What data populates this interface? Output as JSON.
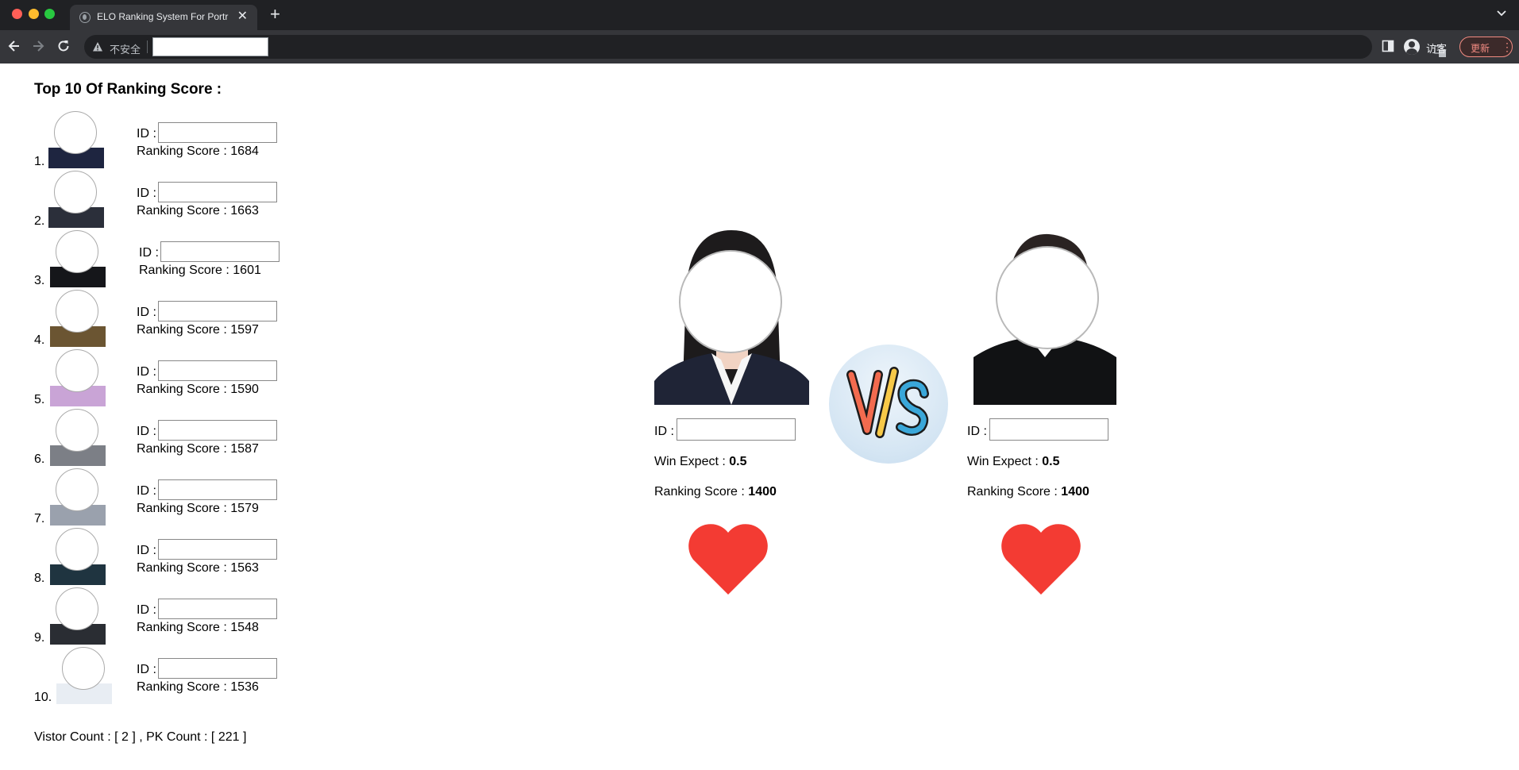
{
  "browser": {
    "tab_title": "ELO Ranking System For Portr",
    "close_glyph": "✕",
    "new_tab_glyph": "+",
    "security_label": "不安全",
    "profile_label": "访客",
    "update_label": "更新",
    "menu_glyph": "⋮"
  },
  "page": {
    "title": "Top 10 Of Ranking Score :",
    "id_label": "ID :",
    "ranking": [
      {
        "rank": "1.",
        "score_text": "Ranking Score : 1684",
        "shirt": "#1e2540"
      },
      {
        "rank": "2.",
        "score_text": "Ranking Score : 1663",
        "shirt": "#2b2f3a"
      },
      {
        "rank": "3.",
        "score_text": "Ranking Score : 1601",
        "shirt": "#15161a"
      },
      {
        "rank": "4.",
        "score_text": "Ranking Score : 1597",
        "shirt": "#6b5532"
      },
      {
        "rank": "5.",
        "score_text": "Ranking Score : 1590",
        "shirt": "#c9a4d6"
      },
      {
        "rank": "6.",
        "score_text": "Ranking Score : 1587",
        "shirt": "#7c7f86"
      },
      {
        "rank": "7.",
        "score_text": "Ranking Score : 1579",
        "shirt": "#9aa1ad"
      },
      {
        "rank": "8.",
        "score_text": "Ranking Score : 1563",
        "shirt": "#1f3440"
      },
      {
        "rank": "9.",
        "score_text": "Ranking Score : 1548",
        "shirt": "#2a2d33"
      },
      {
        "rank": "10.",
        "score_text": "Ranking Score : 1536",
        "shirt": "#e8edf3"
      }
    ],
    "footer": "Vistor Count : [ 2 ] , PK Count : [ 221 ]",
    "contestants": [
      {
        "id_label": "ID :",
        "win_label": "Win Expect :",
        "win_value": "0.5",
        "score_label": "Ranking Score :",
        "score_value": "1400"
      },
      {
        "id_label": "ID :",
        "win_label": "Win Expect :",
        "win_value": "0.5",
        "score_label": "Ranking Score :",
        "score_value": "1400"
      }
    ]
  },
  "colors": {
    "heart": "#f33b33",
    "vs_orange": "#f26b4f",
    "vs_yellow": "#f7c948",
    "vs_blue": "#3aa7d9",
    "update_accent": "#f28b82"
  },
  "icons": [
    "back-icon",
    "forward-icon",
    "reload-icon",
    "warning-icon",
    "translate-icon",
    "side-panel-icon",
    "globe-icon",
    "heart-icon",
    "vs-icon"
  ]
}
